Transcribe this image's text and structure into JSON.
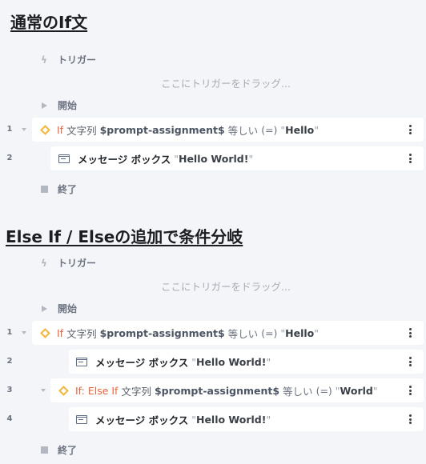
{
  "sections": [
    {
      "heading": "通常のIf文",
      "trigger_label": "トリガー",
      "drop_hint": "ここにトリガーをドラッグ...",
      "start_label": "開始",
      "end_label": "終了",
      "rows": [
        {
          "line": "1",
          "keyword": "If",
          "type_text": "文字列",
          "variable": "$prompt-assignment$",
          "op_text": "等しい",
          "op_symbol": "(=)",
          "value_q_open": "\"",
          "value": "Hello",
          "value_q_close": "\""
        },
        {
          "line": "2",
          "action": "メッセージ ボックス",
          "q_open": "\"",
          "text": "Hello World!",
          "q_close": "\""
        }
      ]
    },
    {
      "heading": "Else If / Elseの追加で条件分岐",
      "trigger_label": "トリガー",
      "drop_hint": "ここにトリガーをドラッグ...",
      "start_label": "開始",
      "end_label": "終了",
      "rows": [
        {
          "line": "1",
          "keyword": "If",
          "type_text": "文字列",
          "variable": "$prompt-assignment$",
          "op_text": "等しい",
          "op_symbol": "(=)",
          "value_q_open": "\"",
          "value": "Hello",
          "value_q_close": "\""
        },
        {
          "line": "2",
          "action": "メッセージ ボックス",
          "q_open": "\"",
          "text": "Hello World!",
          "q_close": "\""
        },
        {
          "line": "3",
          "keyword": "If: Else If",
          "type_text": "文字列",
          "variable": "$prompt-assignment$",
          "op_text": "等しい",
          "op_symbol": "(=)",
          "value_q_open": "\"",
          "value": "World",
          "value_q_close": "\""
        },
        {
          "line": "4",
          "action": "メッセージ ボックス",
          "q_open": "\"",
          "text": "Hello World!",
          "q_close": "\""
        }
      ]
    }
  ],
  "icons": {
    "trigger": "bolt-icon",
    "start": "play-icon",
    "end": "stop-icon",
    "condition": "diamond-icon",
    "message": "message-box-icon",
    "menu": "kebab-menu-icon",
    "collapse": "caret-down-icon"
  },
  "colors": {
    "background": "#f4f5f8",
    "card": "#ffffff",
    "keyword": "#e8643c",
    "diamond": "#f3b63a",
    "message_icon": "#5b6b86"
  }
}
